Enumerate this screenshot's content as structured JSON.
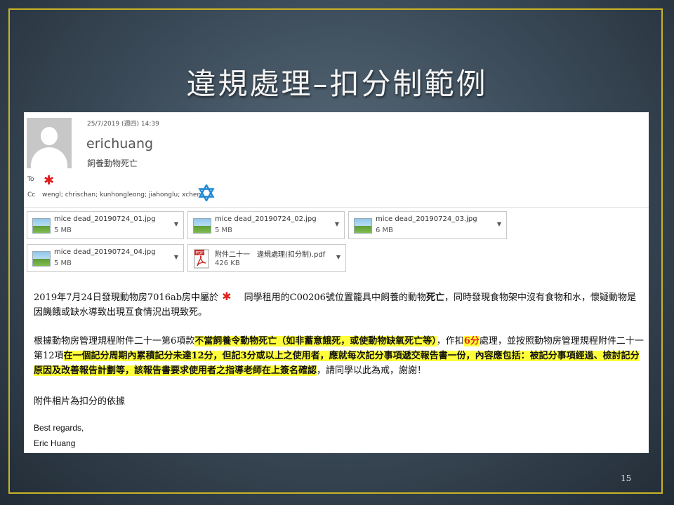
{
  "slide": {
    "title": "違規處理–扣分制範例",
    "page_number": "15"
  },
  "email": {
    "date": "25/7/2019 (週四) 14:39",
    "sender": "erichuang",
    "subject": "飼養動物死亡",
    "to_label": "To",
    "cc_label": "Cc",
    "cc_list": "wengl; chrischan; kunhongleong; jiahonglu; xchen;",
    "attachments": [
      {
        "name": "mice dead_20190724_01.jpg",
        "size": "5 MB",
        "type": "image"
      },
      {
        "name": "mice dead_20190724_02.jpg",
        "size": "5 MB",
        "type": "image"
      },
      {
        "name": "mice dead_20190724_03.jpg",
        "size": "6 MB",
        "type": "image"
      },
      {
        "name": "mice dead_20190724_04.jpg",
        "size": "5 MB",
        "type": "image"
      },
      {
        "name": "附件二十一　違規處理(扣分制).pdf",
        "size": "426 KB",
        "type": "pdf"
      }
    ],
    "para1": {
      "a": "2019年7月24日發現動物房7016ab房中屬於",
      "b": "同學租用的C00206號位置籠具中飼養的動物",
      "c": "死亡",
      "d": "，同時發現食物架中沒有食物和水，懷疑動物是因饑餓或缺水導致出現互食情況出現致死。"
    },
    "para2": {
      "a": "根據動物房管理規程附件二十一第6項款",
      "b": "不當飼養令動物死亡（如非蓄意餓死，或使動物缺氧死亡等）",
      "c": "，作扣",
      "d": "6分",
      "e": "處理，並按照動物房管理規程附件二十一第12項",
      "f": "在一個記分周期內累積記分未達12分，但記3分或以上之使用者，應就每次記分事項遞交報告書一份，內容應包括：被記分事項經過、檢討記分原因及改善報告計劃等，該報告書要求使用者之指導老師在上簽名確認",
      "g": "，請同學以此為戒，謝謝！"
    },
    "para3": "附件相片為扣分的依據",
    "closing": "Best regards,",
    "signature": "Eric Huang"
  }
}
